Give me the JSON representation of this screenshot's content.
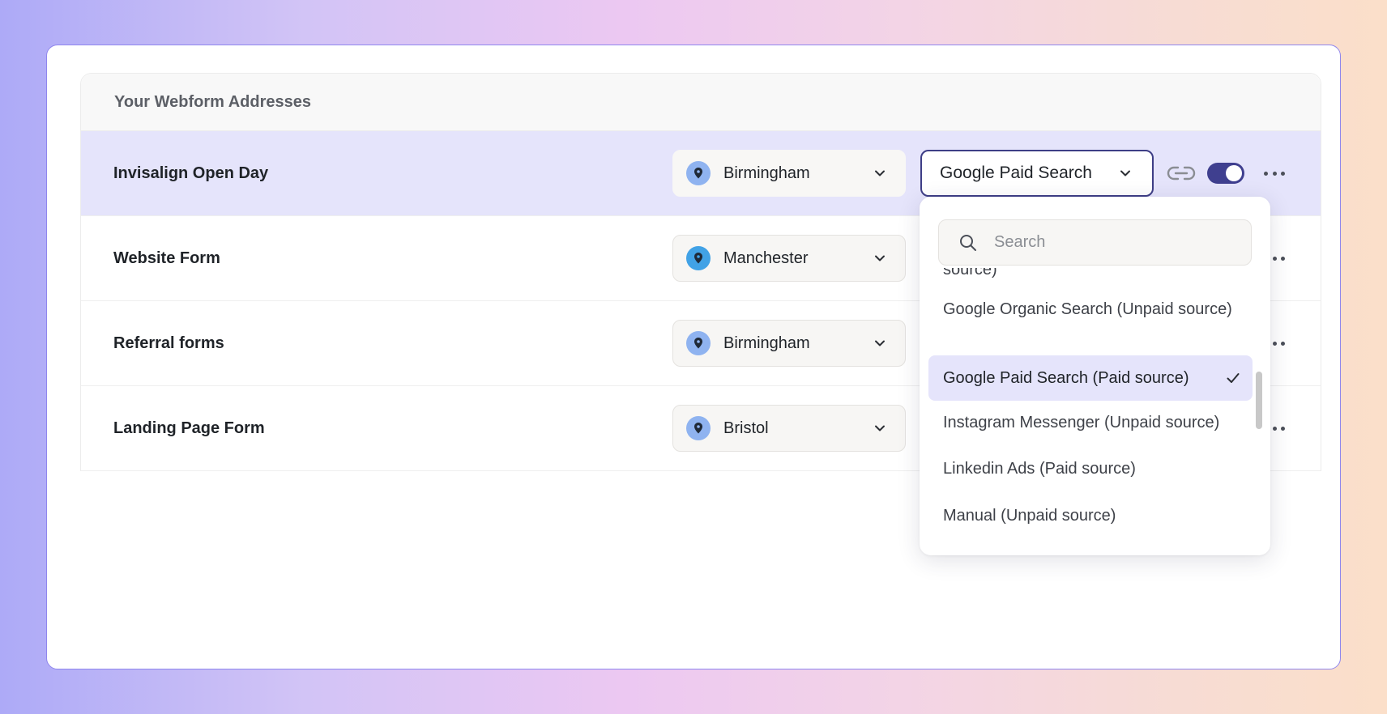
{
  "card": {
    "title": "Your Webform Addresses"
  },
  "rows": [
    {
      "name": "Invisalign Open Day",
      "location": "Birmingham",
      "source": "Google Paid Search",
      "enabled": true,
      "pin_color": "#8fb3f0"
    },
    {
      "name": "Website Form",
      "location": "Manchester",
      "pin_color": "#41a2e6"
    },
    {
      "name": "Referral forms",
      "location": "Birmingham",
      "pin_color": "#8fb3f0"
    },
    {
      "name": "Landing Page Form",
      "location": "Bristol",
      "pin_color": "#8fb3f0"
    }
  ],
  "dropdown": {
    "search_placeholder": "Search",
    "options": [
      {
        "label": "source)"
      },
      {
        "label": "Google Organic Search (Unpaid source)"
      },
      {
        "label": "Google Paid Search (Paid source)",
        "selected": true
      },
      {
        "label": "Instagram Messenger (Unpaid source)"
      },
      {
        "label": "Linkedin Ads (Paid source)"
      },
      {
        "label": "Manual (Unpaid source)"
      }
    ]
  },
  "icons": {
    "pin": "map-pin-icon",
    "chevron": "chevron-down-icon",
    "link": "link-icon",
    "more": "more-horizontal-icon",
    "search": "search-icon",
    "check": "check-icon"
  },
  "colors": {
    "accent": "#3e3e86",
    "selected_row": "#e5e4fb",
    "toggle_on": "#3f3f8f"
  }
}
